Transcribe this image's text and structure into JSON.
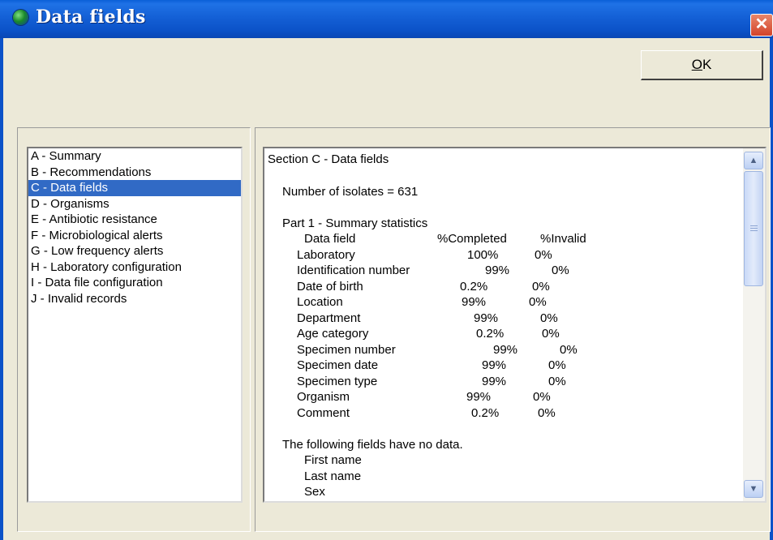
{
  "window": {
    "title": "Data fields",
    "close_symbol": "✕"
  },
  "ok_button": {
    "label": "OK",
    "mnemonic": "O",
    "rest": "K"
  },
  "sections": [
    "A - Summary",
    "B - Recommendations",
    "C - Data fields",
    "D - Organisms",
    "E - Antibiotic resistance",
    "F - Microbiological alerts",
    "G - Low frequency alerts",
    "H - Laboratory configuration",
    "I - Data file configuration",
    "J - Invalid records"
  ],
  "selected_index": 2,
  "report": {
    "heading": "Section C - Data fields",
    "isolates": "Number of isolates = 631",
    "part_title": "Part 1 - Summary statistics",
    "headers": {
      "field": "Data field",
      "completed": "%Completed",
      "invalid": "%Invalid"
    },
    "rows": [
      {
        "field": "Laboratory",
        "completed": "100%",
        "invalid": "0%"
      },
      {
        "field": "Identification number",
        "completed": "99%",
        "invalid": "0%"
      },
      {
        "field": "Date of birth",
        "completed": "0.2%",
        "invalid": "0%"
      },
      {
        "field": "Location",
        "completed": "99%",
        "invalid": "0%"
      },
      {
        "field": "Department",
        "completed": "99%",
        "invalid": "0%"
      },
      {
        "field": "Age category",
        "completed": "0.2%",
        "invalid": "0%"
      },
      {
        "field": "Specimen number",
        "completed": "99%",
        "invalid": "0%"
      },
      {
        "field": "Specimen date",
        "completed": "99%",
        "invalid": "0%"
      },
      {
        "field": "Specimen type",
        "completed": "99%",
        "invalid": "0%"
      },
      {
        "field": "Organism",
        "completed": "99%",
        "invalid": "0%"
      },
      {
        "field": "Comment",
        "completed": "0.2%",
        "invalid": "0%"
      }
    ],
    "no_data_title": "The following fields have no data.",
    "no_data_fields": [
      "First name",
      "Last name",
      "Sex"
    ]
  },
  "colors": {
    "titlebar": "#0b52c8",
    "selection": "#316ac5",
    "dialog_bg": "#ece9d8"
  }
}
